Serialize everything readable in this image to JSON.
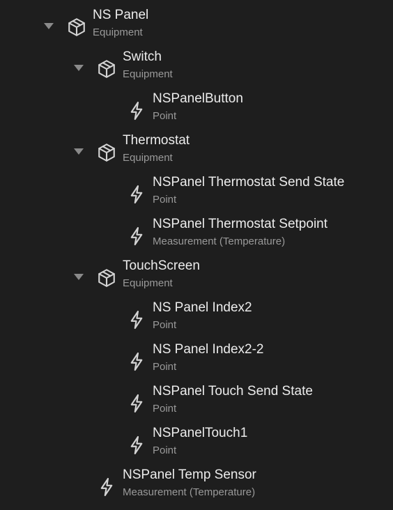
{
  "tree": [
    {
      "level": 0,
      "expanded": true,
      "icon": "equipment-cube-icon",
      "title": "NS Panel",
      "subtitle": "Equipment"
    },
    {
      "level": 1,
      "expanded": true,
      "icon": "equipment-cube-icon",
      "title": "Switch",
      "subtitle": "Equipment"
    },
    {
      "level": 2,
      "icon": "point-bolt-icon",
      "title": "NSPanelButton",
      "subtitle": "Point"
    },
    {
      "level": 1,
      "expanded": true,
      "icon": "equipment-cube-icon",
      "title": "Thermostat",
      "subtitle": "Equipment"
    },
    {
      "level": 2,
      "icon": "point-bolt-icon",
      "title": "NSPanel Thermostat Send State",
      "subtitle": "Point"
    },
    {
      "level": 2,
      "icon": "point-bolt-icon",
      "title": "NSPanel Thermostat Setpoint",
      "subtitle": "Measurement (Temperature)"
    },
    {
      "level": 1,
      "expanded": true,
      "icon": "equipment-cube-icon",
      "title": "TouchScreen",
      "subtitle": "Equipment"
    },
    {
      "level": 2,
      "icon": "point-bolt-icon",
      "title": "NS Panel Index2",
      "subtitle": "Point"
    },
    {
      "level": 2,
      "icon": "point-bolt-icon",
      "title": "NS Panel Index2-2",
      "subtitle": "Point"
    },
    {
      "level": 2,
      "icon": "point-bolt-icon",
      "title": "NSPanel Touch Send State",
      "subtitle": "Point"
    },
    {
      "level": 2,
      "icon": "point-bolt-icon",
      "title": "NSPanelTouch1",
      "subtitle": "Point"
    },
    {
      "level": 1,
      "icon": "point-bolt-icon",
      "title": "NSPanel Temp Sensor",
      "subtitle": "Measurement (Temperature)"
    }
  ],
  "colors": {
    "background": "#1e1e1e",
    "title": "#ececec",
    "subtitle": "#9a9a9a",
    "icon": "#d4d4d4",
    "toggle": "#8a8a8a"
  }
}
